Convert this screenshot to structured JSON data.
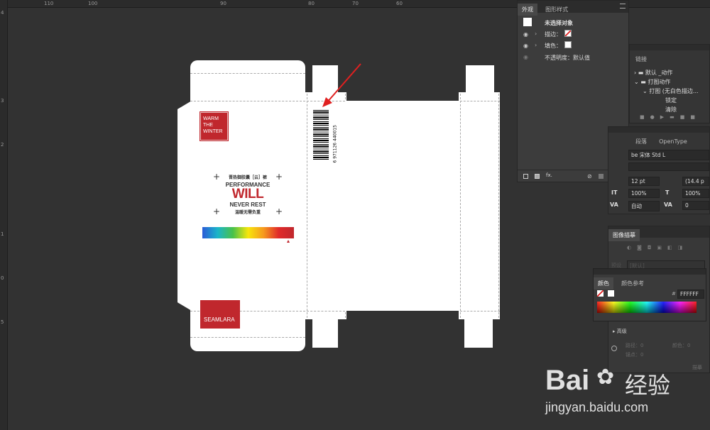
{
  "ruler": {
    "top": [
      "110",
      "100",
      "90",
      "80",
      "70",
      "60"
    ],
    "left": [
      "4",
      "3",
      "2",
      "1",
      "0",
      "5"
    ]
  },
  "box": {
    "logo_lines": [
      "WARM",
      "THE",
      "WINTER"
    ],
    "tagline_cn": "晋热御胶囊［云］裤",
    "performance": "PERFORMANCE",
    "will": "WILL",
    "never_rest": "NEVER REST",
    "slogan_cn": "温暖无需负重",
    "brand": "SEAMLARA",
    "barcode_number": "6 971126 440015"
  },
  "appearance_panel": {
    "tabs": [
      "外观",
      "图形样式"
    ],
    "title": "未选择对象",
    "stroke_label": "描边：",
    "fill_label": "填色：",
    "opacity": "不透明度：默认值",
    "fx": "fx."
  },
  "actions_panel": {
    "tab": "链接",
    "items": [
      "默认 _动作",
      "打图动作",
      "打图 (无白色描边...",
      "锁定",
      "清除"
    ]
  },
  "char_panel": {
    "tabs": [
      "段落",
      "OpenType"
    ],
    "font": "be 宋体 Std L",
    "size": "12 pt",
    "leading": "(14.4 p",
    "h_scale": "100%",
    "v_scale": "100%",
    "kerning": "自动",
    "tracking": "0"
  },
  "trace_panel": {
    "title": "图像描摹",
    "preset_label": "预设",
    "preset_value": "[默认]",
    "advanced": "高级",
    "paths": "路径：0",
    "colors": "颜色：0",
    "anchors": "锚点：0",
    "trace_button": "描摹"
  },
  "color_panel": {
    "tabs": [
      "颜色",
      "颜色参考"
    ],
    "hex": "FFFFFF"
  },
  "watermark": {
    "brand": "Bai",
    "brand2": "经验",
    "url": "jingyan.baidu.com"
  },
  "colors": {
    "accent_red": "#c0272d",
    "canvas": "#323232"
  }
}
